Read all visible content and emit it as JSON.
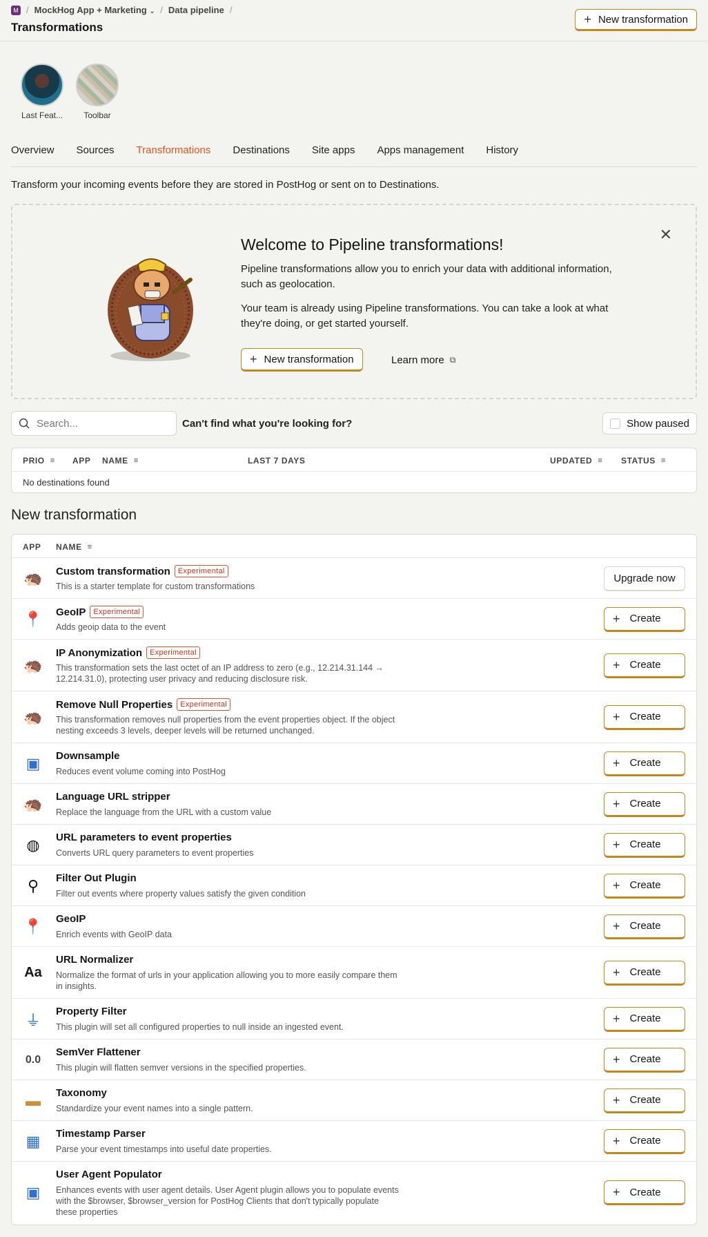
{
  "breadcrumbs": {
    "org_initial": "M",
    "project": "MockHog App + Marketing",
    "section": "Data pipeline",
    "separator": "/"
  },
  "header": {
    "title": "Transformations",
    "new_button": "New transformation"
  },
  "avatars": [
    {
      "label": "Last Feat..."
    },
    {
      "label": "Toolbar"
    }
  ],
  "tabs": [
    "Overview",
    "Sources",
    "Transformations",
    "Destinations",
    "Site apps",
    "Apps management",
    "History"
  ],
  "active_tab": "Transformations",
  "intro": "Transform your incoming events before they are stored in PostHog or sent on to Destinations.",
  "welcome": {
    "title": "Welcome to Pipeline transformations!",
    "p1": "Pipeline transformations allow you to enrich your data with additional information, such as geolocation.",
    "p2": "Your team is already using Pipeline transformations. You can take a look at what they're doing, or get started yourself.",
    "button": "New transformation",
    "learn_more": "Learn more"
  },
  "filters": {
    "search_placeholder": "Search...",
    "cant_find": "Can't find what you're looking for?",
    "show_paused": "Show paused"
  },
  "table1": {
    "columns": {
      "prio": "PRIO",
      "app": "APP",
      "name": "NAME",
      "last7": "LAST 7 DAYS",
      "updated": "UPDATED",
      "status": "STATUS"
    },
    "empty": "No destinations found"
  },
  "new_section": {
    "title": "New transformation",
    "columns": {
      "app": "APP",
      "name": "NAME"
    },
    "badge_text": "Experimental",
    "rows": [
      {
        "icon": "hedgehog-icon",
        "title": "Custom transformation",
        "experimental": true,
        "desc": "This is a starter template for custom transformations",
        "button": "Upgrade now"
      },
      {
        "icon": "geoip-icon",
        "title": "GeoIP",
        "experimental": true,
        "desc": "Adds geoip data to the event",
        "button": "Create"
      },
      {
        "icon": "hedgehog-icon",
        "title": "IP Anonymization",
        "experimental": true,
        "desc": "This transformation sets the last octet of an IP address to zero (e.g., 12.214.31.144 → 12.214.31.0), protecting user privacy and reducing disclosure risk.",
        "button": "Create"
      },
      {
        "icon": "hedgehog-icon",
        "title": "Remove Null Properties",
        "experimental": true,
        "desc": "This transformation removes null properties from the event properties object. If the object nesting exceeds 3 levels, deeper levels will be returned unchanged.",
        "button": "Create"
      },
      {
        "icon": "downsample-icon",
        "title": "Downsample",
        "experimental": false,
        "desc": "Reduces event volume coming into PostHog",
        "button": "Create"
      },
      {
        "icon": "hedgehog-icon",
        "title": "Language URL stripper",
        "experimental": false,
        "desc": "Replace the language from the URL with a custom value",
        "button": "Create"
      },
      {
        "icon": "url-params-icon",
        "title": "URL parameters to event properties",
        "experimental": false,
        "desc": "Converts URL query parameters to event properties",
        "button": "Create"
      },
      {
        "icon": "filter-out-icon",
        "title": "Filter Out Plugin",
        "experimental": false,
        "desc": "Filter out events where property values satisfy the given condition",
        "button": "Create"
      },
      {
        "icon": "geoip-icon",
        "title": "GeoIP",
        "experimental": false,
        "desc": "Enrich events with GeoIP data",
        "button": "Create"
      },
      {
        "icon": "text-normalize-icon",
        "title": "URL Normalizer",
        "experimental": false,
        "desc": "Normalize the format of urls in your application allowing you to more easily compare them in insights.",
        "button": "Create"
      },
      {
        "icon": "funnel-icon",
        "title": "Property Filter",
        "experimental": false,
        "desc": "This plugin will set all configured properties to null inside an ingested event.",
        "button": "Create"
      },
      {
        "icon": "semver-icon",
        "title": "SemVer Flattener",
        "experimental": false,
        "desc": "This plugin will flatten semver versions in the specified properties.",
        "button": "Create"
      },
      {
        "icon": "taxonomy-icon",
        "title": "Taxonomy",
        "experimental": false,
        "desc": "Standardize your event names into a single pattern.",
        "button": "Create"
      },
      {
        "icon": "calendar-clock-icon",
        "title": "Timestamp Parser",
        "experimental": false,
        "desc": "Parse your event timestamps into useful date properties.",
        "button": "Create"
      },
      {
        "icon": "user-card-icon",
        "title": "User Agent Populator",
        "experimental": false,
        "desc": "Enhances events with user agent details. User Agent plugin allows you to populate events with the $browser, $browser_version for PostHog Clients that don't typically populate these properties",
        "button": "Create"
      }
    ]
  },
  "colors": {
    "accent": "#e2541f",
    "button_border": "#c4871f",
    "badge": "#c8331c"
  }
}
